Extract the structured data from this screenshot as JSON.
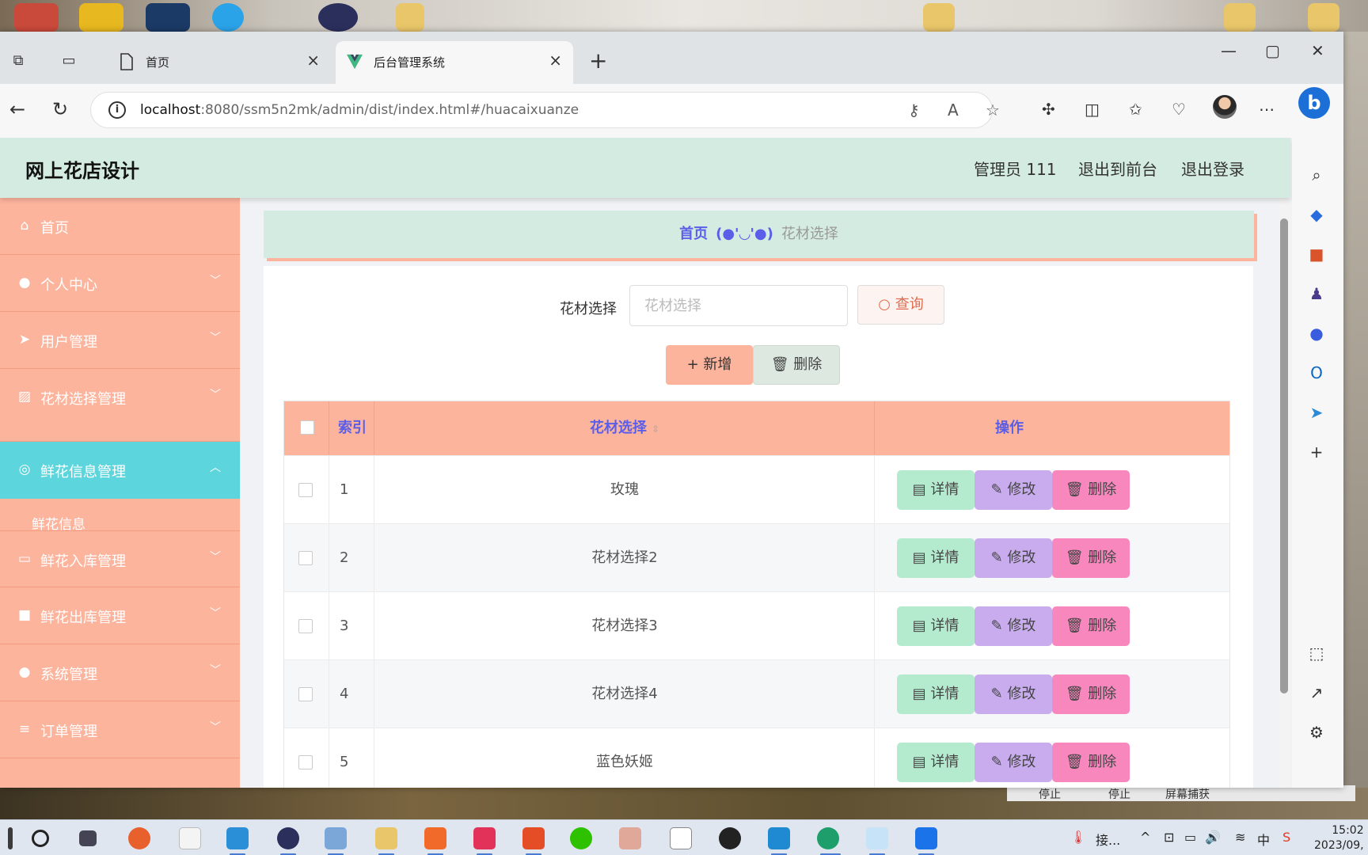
{
  "browser": {
    "tabs": [
      {
        "label": "首页",
        "active": false
      },
      {
        "label": "后台管理系统",
        "active": true
      }
    ],
    "url_host": "localhost",
    "url_rest": ":8080/ssm5n2mk/admin/dist/index.html#/huacaixuanze"
  },
  "app": {
    "title": "网上花店设计",
    "user": "管理员 111",
    "to_front": "退出到前台",
    "logout": "退出登录"
  },
  "sidebar": {
    "items": [
      {
        "label": "首页",
        "icon": "home-icon",
        "has_arrow": false
      },
      {
        "label": "个人中心",
        "icon": "user-icon",
        "has_arrow": true
      },
      {
        "label": "用户管理",
        "icon": "send-icon",
        "has_arrow": true
      },
      {
        "label": "花材选择管理",
        "icon": "chart-icon",
        "has_arrow": true
      },
      {
        "label": "鲜花信息管理",
        "icon": "compass-icon",
        "has_arrow": true,
        "active": true
      },
      {
        "label": "鲜花入库管理",
        "icon": "card-icon",
        "has_arrow": true
      },
      {
        "label": "鲜花出库管理",
        "icon": "briefcase-icon",
        "has_arrow": true
      },
      {
        "label": "系统管理",
        "icon": "user-icon",
        "has_arrow": true
      },
      {
        "label": "订单管理",
        "icon": "list-icon",
        "has_arrow": true
      }
    ],
    "submenu": "鲜花信息"
  },
  "breadcrumb": {
    "home": "首页",
    "separator": "(●'◡'●)",
    "current": "花材选择"
  },
  "search": {
    "label": "花材选择",
    "placeholder": "花材选择",
    "query_button": "查询"
  },
  "actions": {
    "add": "新增",
    "delete": "删除"
  },
  "table": {
    "columns": [
      "索引",
      "花材选择",
      "操作"
    ],
    "rows": [
      {
        "index": "1",
        "name": "玫瑰"
      },
      {
        "index": "2",
        "name": "花材选择2"
      },
      {
        "index": "3",
        "name": "花材选择3"
      },
      {
        "index": "4",
        "name": "花材选择4"
      },
      {
        "index": "5",
        "name": "蓝色妖姬"
      }
    ],
    "row_actions": {
      "detail": "详情",
      "edit": "修改",
      "delete": "删除"
    }
  },
  "background_window": {
    "labels": [
      "停止",
      "停止",
      "屏幕捕获"
    ]
  },
  "taskbar": {
    "tray_text": "接...",
    "ime": "中",
    "time": "15:02",
    "date": "2023/09,"
  },
  "colors": {
    "header": "#d4ebe2",
    "sidebar": "#fdb49d",
    "active_menu": "#5dd5dd",
    "accent_text": "#5b5ee8",
    "detail_btn": "#b4ebcf",
    "edit_btn": "#c9acee",
    "delete_btn": "#f887be"
  }
}
